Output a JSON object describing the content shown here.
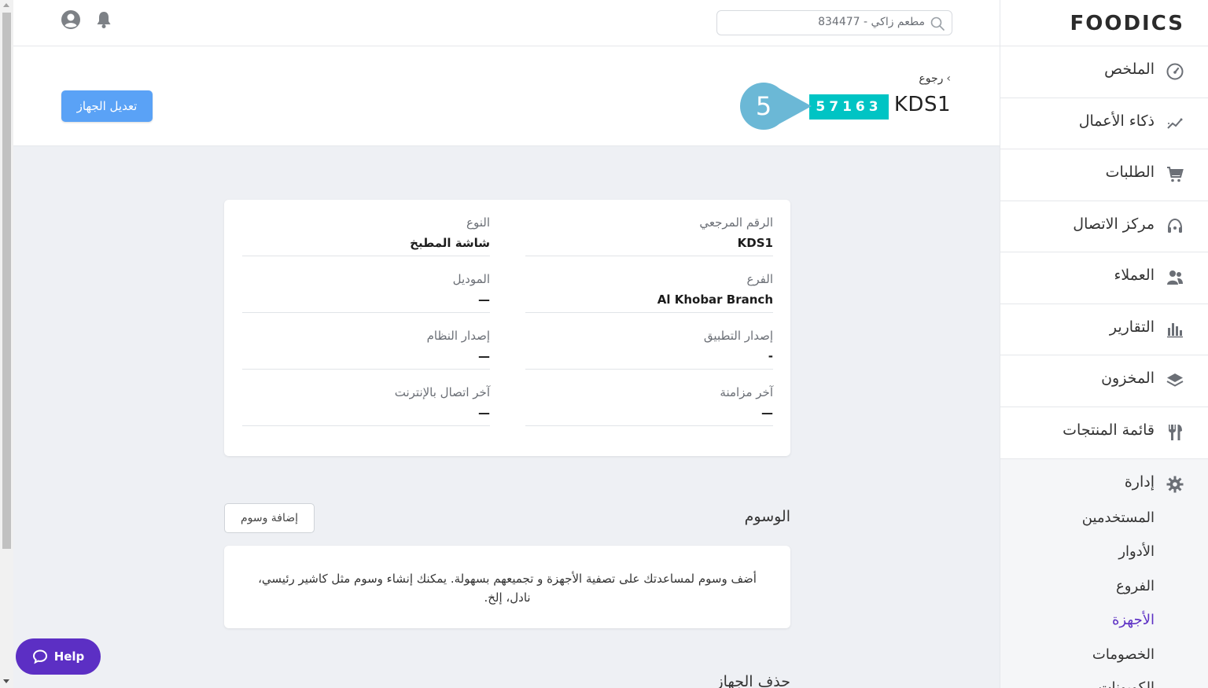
{
  "topbar": {
    "search_value": "مطعم زاكي - 834477"
  },
  "header": {
    "back_label": "رجوع",
    "device_title": "KDS1",
    "device_code": "57163",
    "step_number": "5",
    "edit_button_label": "تعديل الجهاز"
  },
  "details": {
    "reference_label": "الرقم المرجعي",
    "reference_value": "KDS1",
    "type_label": "النوع",
    "type_value": "شاشة المطبخ",
    "branch_label": "الفرع",
    "branch_value": "Al Khobar Branch",
    "model_label": "الموديل",
    "model_value": "—",
    "app_version_label": "إصدار التطبيق",
    "app_version_value": "-",
    "os_version_label": "إصدار النظام",
    "os_version_value": "—",
    "last_sync_label": "آخر مزامنة",
    "last_sync_value": "—",
    "last_online_label": "آخر اتصال بالإنترنت",
    "last_online_value": "—"
  },
  "tags": {
    "title": "الوسوم",
    "add_button_label": "إضافة وسوم",
    "description": "أضف وسوم لمساعدتك على تصفية الأجهزة و تجميعهم بسهولة. يمكنك إنشاء وسوم مثل كاشير رئيسي، نادل، إلخ."
  },
  "delete_section": {
    "title": "حذف الجهاز"
  },
  "help": {
    "label": "Help"
  },
  "sidebar": {
    "logo": "FOODICS",
    "items": [
      {
        "label": "الملخص",
        "icon": "dashboard-icon"
      },
      {
        "label": "ذكاء الأعمال",
        "icon": "trend-icon"
      },
      {
        "label": "الطلبات",
        "icon": "cart-icon"
      },
      {
        "label": "مركز الاتصال",
        "icon": "headset-icon"
      },
      {
        "label": "العملاء",
        "icon": "customers-icon"
      },
      {
        "label": "التقارير",
        "icon": "reports-icon"
      },
      {
        "label": "المخزون",
        "icon": "layers-icon"
      },
      {
        "label": "قائمة المنتجات",
        "icon": "utensils-icon"
      }
    ],
    "admin": {
      "label": "إدارة",
      "icon": "gear-icon",
      "sub_items": [
        "المستخدمين",
        "الأدوار",
        "الفروع",
        "الأجهزة",
        "الخصومات",
        "الكوبونات"
      ],
      "active_item": "الأجهزة"
    }
  },
  "colors": {
    "accent": "#5c2fc4",
    "primary_button": "#5aa2f6",
    "code_badge": "#00c4c4",
    "step_marker": "#6bb8d6"
  }
}
